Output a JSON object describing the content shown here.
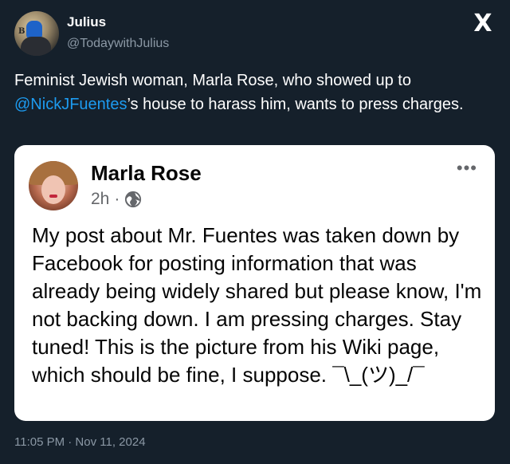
{
  "tweet": {
    "author_name": "Julius",
    "author_handle": "@TodaywithJulius",
    "text_before": "Feminist Jewish woman, Marla Rose, who showed up to ",
    "mention": "@NickJFuentes",
    "text_after": "’s house to harass him, wants to press charges.",
    "timestamp": "11:05 PM · Nov 11, 2024",
    "platform_logo": "X"
  },
  "embedded_post": {
    "author_name": "Marla Rose",
    "time": "2h",
    "separator": "·",
    "visibility_icon": "globe-icon",
    "more_icon": "•••",
    "text": "My post about Mr. Fuentes was taken down by Facebook for posting information that was already being widely shared but please know, I'm not backing down. I am pressing charges. Stay tuned! This is the picture from his Wiki page, which should be fine, I suppose. ¯\\_(ツ)_/¯"
  },
  "colors": {
    "background": "#15202b",
    "mention": "#1d9bf0",
    "secondary_text": "#8b98a5",
    "card_background": "#ffffff"
  }
}
